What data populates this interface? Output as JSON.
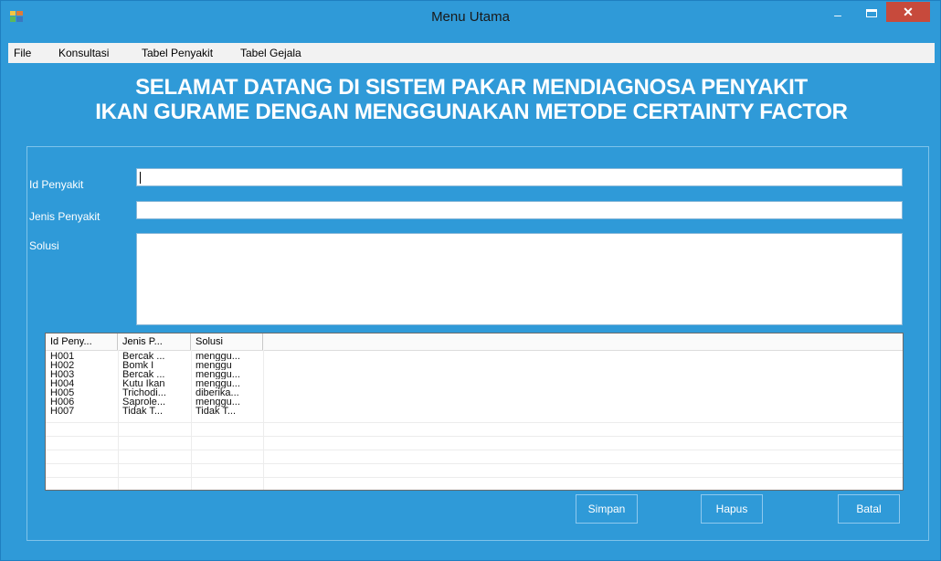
{
  "window": {
    "title": "Menu Utama",
    "min_glyph": "–",
    "close_glyph": "✕"
  },
  "menu": {
    "items": [
      "File",
      "Konsultasi",
      "Tabel Penyakit",
      "Tabel Gejala"
    ]
  },
  "heading": {
    "line1": "SELAMAT DATANG DI SISTEM PAKAR MENDIAGNOSA PENYAKIT",
    "line2": "IKAN GURAME DENGAN MENGGUNAKAN METODE CERTAINTY FACTOR"
  },
  "form": {
    "id_label": "Id Penyakit",
    "id_value": "",
    "jenis_label": "Jenis Penyakit",
    "jenis_value": "",
    "solusi_label": "Solusi",
    "solusi_value": ""
  },
  "table": {
    "columns": [
      "Id Peny...",
      "Jenis P...",
      "Solusi"
    ],
    "rows": [
      [
        "H001",
        "Bercak ...",
        "menggu..."
      ],
      [
        "H002",
        "Bomk I",
        "menggu"
      ],
      [
        "H003",
        "Bercak ...",
        "menggu..."
      ],
      [
        "H004",
        "Kutu Ikan",
        "menggu..."
      ],
      [
        "H005",
        "Trichodi...",
        "diberika..."
      ],
      [
        "H006",
        "Saprole...",
        "menggu..."
      ],
      [
        "H007",
        "Tidak T...",
        "Tidak T..."
      ]
    ]
  },
  "buttons": {
    "simpan": "Simpan",
    "hapus": "Hapus",
    "batal": "Batal"
  },
  "colors": {
    "background": "#2f9ad8",
    "close": "#c74a3c",
    "text_on_bg": "#ffffff"
  }
}
